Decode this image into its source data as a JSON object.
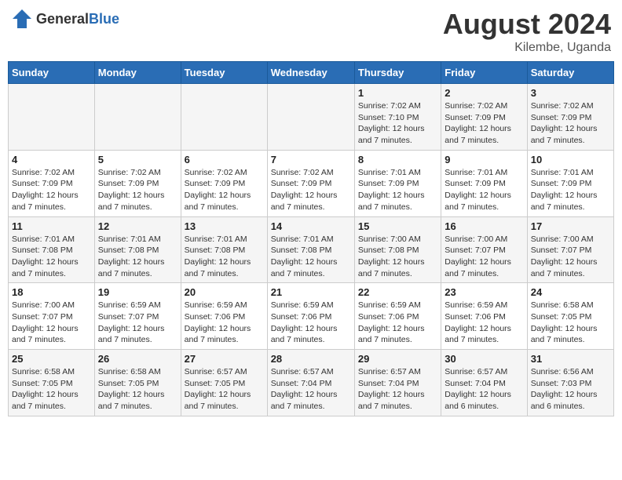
{
  "logo": {
    "general": "General",
    "blue": "Blue"
  },
  "title": "August 2024",
  "subtitle": "Kilembe, Uganda",
  "days_of_week": [
    "Sunday",
    "Monday",
    "Tuesday",
    "Wednesday",
    "Thursday",
    "Friday",
    "Saturday"
  ],
  "weeks": [
    [
      {
        "num": "",
        "info": ""
      },
      {
        "num": "",
        "info": ""
      },
      {
        "num": "",
        "info": ""
      },
      {
        "num": "",
        "info": ""
      },
      {
        "num": "1",
        "info": "Sunrise: 7:02 AM\nSunset: 7:10 PM\nDaylight: 12 hours and 7 minutes."
      },
      {
        "num": "2",
        "info": "Sunrise: 7:02 AM\nSunset: 7:09 PM\nDaylight: 12 hours and 7 minutes."
      },
      {
        "num": "3",
        "info": "Sunrise: 7:02 AM\nSunset: 7:09 PM\nDaylight: 12 hours and 7 minutes."
      }
    ],
    [
      {
        "num": "4",
        "info": "Sunrise: 7:02 AM\nSunset: 7:09 PM\nDaylight: 12 hours and 7 minutes."
      },
      {
        "num": "5",
        "info": "Sunrise: 7:02 AM\nSunset: 7:09 PM\nDaylight: 12 hours and 7 minutes."
      },
      {
        "num": "6",
        "info": "Sunrise: 7:02 AM\nSunset: 7:09 PM\nDaylight: 12 hours and 7 minutes."
      },
      {
        "num": "7",
        "info": "Sunrise: 7:02 AM\nSunset: 7:09 PM\nDaylight: 12 hours and 7 minutes."
      },
      {
        "num": "8",
        "info": "Sunrise: 7:01 AM\nSunset: 7:09 PM\nDaylight: 12 hours and 7 minutes."
      },
      {
        "num": "9",
        "info": "Sunrise: 7:01 AM\nSunset: 7:09 PM\nDaylight: 12 hours and 7 minutes."
      },
      {
        "num": "10",
        "info": "Sunrise: 7:01 AM\nSunset: 7:09 PM\nDaylight: 12 hours and 7 minutes."
      }
    ],
    [
      {
        "num": "11",
        "info": "Sunrise: 7:01 AM\nSunset: 7:08 PM\nDaylight: 12 hours and 7 minutes."
      },
      {
        "num": "12",
        "info": "Sunrise: 7:01 AM\nSunset: 7:08 PM\nDaylight: 12 hours and 7 minutes."
      },
      {
        "num": "13",
        "info": "Sunrise: 7:01 AM\nSunset: 7:08 PM\nDaylight: 12 hours and 7 minutes."
      },
      {
        "num": "14",
        "info": "Sunrise: 7:01 AM\nSunset: 7:08 PM\nDaylight: 12 hours and 7 minutes."
      },
      {
        "num": "15",
        "info": "Sunrise: 7:00 AM\nSunset: 7:08 PM\nDaylight: 12 hours and 7 minutes."
      },
      {
        "num": "16",
        "info": "Sunrise: 7:00 AM\nSunset: 7:07 PM\nDaylight: 12 hours and 7 minutes."
      },
      {
        "num": "17",
        "info": "Sunrise: 7:00 AM\nSunset: 7:07 PM\nDaylight: 12 hours and 7 minutes."
      }
    ],
    [
      {
        "num": "18",
        "info": "Sunrise: 7:00 AM\nSunset: 7:07 PM\nDaylight: 12 hours and 7 minutes."
      },
      {
        "num": "19",
        "info": "Sunrise: 6:59 AM\nSunset: 7:07 PM\nDaylight: 12 hours and 7 minutes."
      },
      {
        "num": "20",
        "info": "Sunrise: 6:59 AM\nSunset: 7:06 PM\nDaylight: 12 hours and 7 minutes."
      },
      {
        "num": "21",
        "info": "Sunrise: 6:59 AM\nSunset: 7:06 PM\nDaylight: 12 hours and 7 minutes."
      },
      {
        "num": "22",
        "info": "Sunrise: 6:59 AM\nSunset: 7:06 PM\nDaylight: 12 hours and 7 minutes."
      },
      {
        "num": "23",
        "info": "Sunrise: 6:59 AM\nSunset: 7:06 PM\nDaylight: 12 hours and 7 minutes."
      },
      {
        "num": "24",
        "info": "Sunrise: 6:58 AM\nSunset: 7:05 PM\nDaylight: 12 hours and 7 minutes."
      }
    ],
    [
      {
        "num": "25",
        "info": "Sunrise: 6:58 AM\nSunset: 7:05 PM\nDaylight: 12 hours and 7 minutes."
      },
      {
        "num": "26",
        "info": "Sunrise: 6:58 AM\nSunset: 7:05 PM\nDaylight: 12 hours and 7 minutes."
      },
      {
        "num": "27",
        "info": "Sunrise: 6:57 AM\nSunset: 7:05 PM\nDaylight: 12 hours and 7 minutes."
      },
      {
        "num": "28",
        "info": "Sunrise: 6:57 AM\nSunset: 7:04 PM\nDaylight: 12 hours and 7 minutes."
      },
      {
        "num": "29",
        "info": "Sunrise: 6:57 AM\nSunset: 7:04 PM\nDaylight: 12 hours and 7 minutes."
      },
      {
        "num": "30",
        "info": "Sunrise: 6:57 AM\nSunset: 7:04 PM\nDaylight: 12 hours and 6 minutes."
      },
      {
        "num": "31",
        "info": "Sunrise: 6:56 AM\nSunset: 7:03 PM\nDaylight: 12 hours and 6 minutes."
      }
    ]
  ]
}
